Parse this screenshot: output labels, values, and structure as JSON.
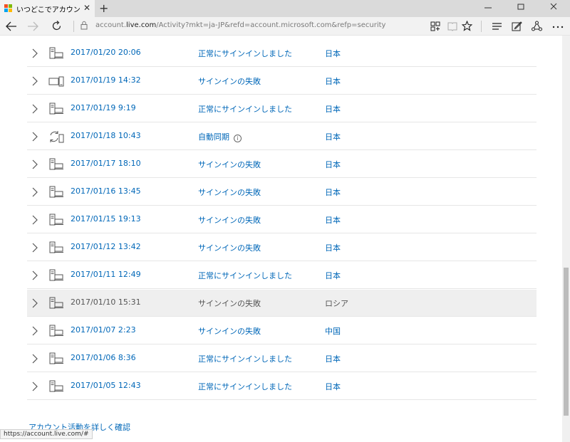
{
  "browser": {
    "tab_title": "いつどこでアカウントを使った",
    "tab_close": "✕",
    "new_tab": "+",
    "url_prefix": "account.",
    "url_host": "live.com",
    "url_path": "/Activity?mkt=ja-JP&refd=account.microsoft.com&refp=security",
    "status_url": "https://account.live.com/#"
  },
  "activity": {
    "rows": [
      {
        "date": "2017/01/20 20:06",
        "status": "正常にサインインしました",
        "location": "日本",
        "device": "desktop",
        "selected": false
      },
      {
        "date": "2017/01/19 14:32",
        "status": "サインインの失敗",
        "location": "日本",
        "device": "tablet-phone",
        "selected": false
      },
      {
        "date": "2017/01/19 9:19",
        "status": "正常にサインインしました",
        "location": "日本",
        "device": "desktop",
        "selected": false
      },
      {
        "date": "2017/01/18 10:43",
        "status": "自動同期",
        "location": "日本",
        "device": "sync",
        "selected": false,
        "info": true
      },
      {
        "date": "2017/01/17 18:10",
        "status": "サインインの失敗",
        "location": "日本",
        "device": "desktop",
        "selected": false
      },
      {
        "date": "2017/01/16 13:45",
        "status": "サインインの失敗",
        "location": "日本",
        "device": "desktop",
        "selected": false
      },
      {
        "date": "2017/01/15 19:13",
        "status": "サインインの失敗",
        "location": "日本",
        "device": "desktop",
        "selected": false
      },
      {
        "date": "2017/01/12 13:42",
        "status": "サインインの失敗",
        "location": "日本",
        "device": "desktop",
        "selected": false
      },
      {
        "date": "2017/01/11 12:49",
        "status": "正常にサインインしました",
        "location": "日本",
        "device": "desktop",
        "selected": false
      },
      {
        "date": "2017/01/10 15:31",
        "status": "サインインの失敗",
        "location": "ロシア",
        "device": "desktop",
        "selected": true
      },
      {
        "date": "2017/01/07 2:23",
        "status": "サインインの失敗",
        "location": "中国",
        "device": "desktop",
        "selected": false
      },
      {
        "date": "2017/01/06 8:36",
        "status": "正常にサインインしました",
        "location": "日本",
        "device": "desktop",
        "selected": false
      },
      {
        "date": "2017/01/05 12:43",
        "status": "正常にサインインしました",
        "location": "日本",
        "device": "desktop",
        "selected": false
      }
    ],
    "more_link": "アカウント活動を詳しく確認"
  },
  "colors": {
    "link": "#0067b8",
    "selected_row": "#efefef",
    "ms_red": "#f25022",
    "ms_green": "#7fba00",
    "ms_blue": "#00a4ef",
    "ms_yellow": "#ffb900"
  }
}
